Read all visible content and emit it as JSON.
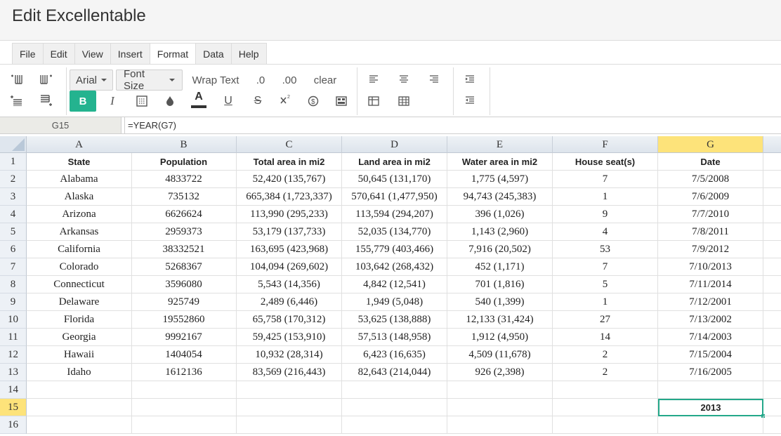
{
  "app": {
    "title": "Edit Excellentable"
  },
  "menu": [
    "File",
    "Edit",
    "View",
    "Insert",
    "Format",
    "Data",
    "Help"
  ],
  "menu_active": "Format",
  "toolbar": {
    "font_family": "Arial",
    "font_size": "Font Size",
    "wrap_text": "Wrap Text",
    "decimal_one": ".0",
    "decimal_two": ".00",
    "clear": "clear",
    "bold": "B",
    "italic": "I",
    "text_color_letter": "A",
    "underline": "U",
    "strike": "S",
    "accent_color": "#24b38f"
  },
  "formula_bar": {
    "cell_ref": "G15",
    "formula": "=YEAR(G7)"
  },
  "sheet": {
    "columns": [
      "A",
      "B",
      "C",
      "D",
      "E",
      "F",
      "G"
    ],
    "selected_column": "G",
    "selected_row": "15",
    "row_numbers": [
      "1",
      "2",
      "3",
      "4",
      "5",
      "6",
      "7",
      "8",
      "9",
      "10",
      "11",
      "12",
      "13",
      "14",
      "15",
      "16"
    ],
    "rows": [
      [
        "State",
        "Population",
        "Total area in mi2",
        "Land area in mi2",
        "Water area in mi2",
        "House seat(s)",
        "Date"
      ],
      [
        "Alabama",
        "4833722",
        "52,420 (135,767)",
        "50,645 (131,170)",
        "1,775 (4,597)",
        "7",
        "7/5/2008"
      ],
      [
        "Alaska",
        "735132",
        "665,384 (1,723,337)",
        "570,641 (1,477,950)",
        "94,743 (245,383)",
        "1",
        "7/6/2009"
      ],
      [
        "Arizona",
        "6626624",
        "113,990 (295,233)",
        "113,594 (294,207)",
        "396 (1,026)",
        "9",
        "7/7/2010"
      ],
      [
        "Arkansas",
        "2959373",
        "53,179 (137,733)",
        "52,035 (134,770)",
        "1,143 (2,960)",
        "4",
        "7/8/2011"
      ],
      [
        "California",
        "38332521",
        "163,695 (423,968)",
        "155,779 (403,466)",
        "7,916 (20,502)",
        "53",
        "7/9/2012"
      ],
      [
        "Colorado",
        "5268367",
        "104,094 (269,602)",
        "103,642 (268,432)",
        "452 (1,171)",
        "7",
        "7/10/2013"
      ],
      [
        "Connecticut",
        "3596080",
        "5,543 (14,356)",
        "4,842 (12,541)",
        "701 (1,816)",
        "5",
        "7/11/2014"
      ],
      [
        "Delaware",
        "925749",
        "2,489 (6,446)",
        "1,949 (5,048)",
        "540 (1,399)",
        "1",
        "7/12/2001"
      ],
      [
        "Florida",
        "19552860",
        "65,758 (170,312)",
        "53,625 (138,888)",
        "12,133 (31,424)",
        "27",
        "7/13/2002"
      ],
      [
        "Georgia",
        "9992167",
        "59,425 (153,910)",
        "57,513 (148,958)",
        "1,912 (4,950)",
        "14",
        "7/14/2003"
      ],
      [
        "Hawaii",
        "1404054",
        "10,932 (28,314)",
        "6,423 (16,635)",
        "4,509 (11,678)",
        "2",
        "7/15/2004"
      ],
      [
        "Idaho",
        "1612136",
        "83,569 (216,443)",
        "82,643 (214,044)",
        "926 (2,398)",
        "2",
        "7/16/2005"
      ],
      [
        "",
        "",
        "",
        "",
        "",
        "",
        ""
      ],
      [
        "",
        "",
        "",
        "",
        "",
        "",
        "2013"
      ],
      [
        "",
        "",
        "",
        "",
        "",
        "",
        ""
      ]
    ]
  }
}
